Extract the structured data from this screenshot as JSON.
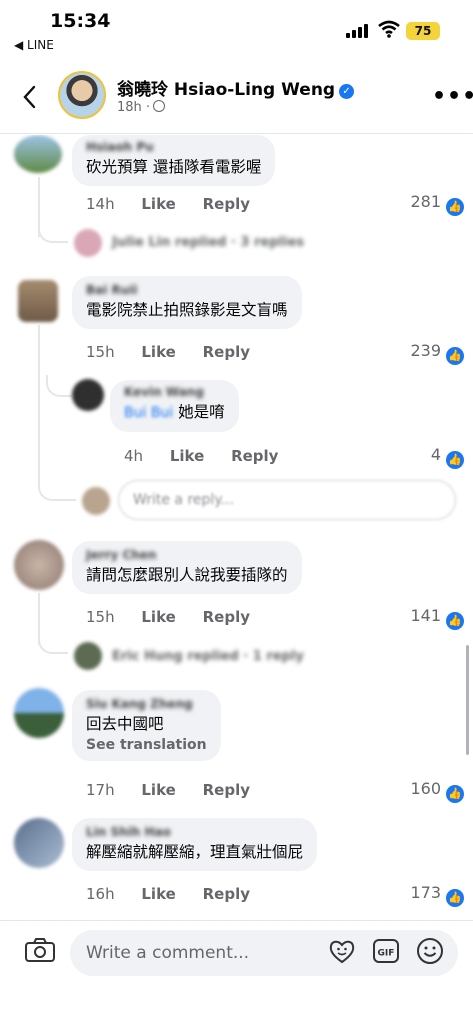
{
  "status_bar": {
    "time": "15:34",
    "back_app": "◀ LINE",
    "battery": "75"
  },
  "header": {
    "author": "翁曉玲 Hsiao-Ling  Weng",
    "time": "18h ·"
  },
  "labels": {
    "like": "Like",
    "reply": "Reply"
  },
  "comments": [
    {
      "name": "Hsiaoh Pu",
      "text": "砍光預算 還插隊看電影喔",
      "time": "14h",
      "likes": "281"
    },
    {
      "name": "Bai Ruii",
      "text": "電影院禁止拍照錄影是文盲嗎",
      "time": "15h",
      "likes": "239"
    },
    {
      "name": "Jerry Chen",
      "text": "請問怎麼跟別人說我要插隊的",
      "time": "15h",
      "likes": "141"
    },
    {
      "name": "Siu Kang Zheng",
      "text": "回去中國吧",
      "translate": "See translation",
      "time": "17h",
      "likes": "160"
    },
    {
      "name": "Lin Shih Hao",
      "text": "解壓縮就解壓縮，理直氣壯個屁",
      "time": "16h",
      "likes": "173"
    }
  ],
  "nested_reply": {
    "name": "Kevin Wang",
    "tag": "Bui Bui",
    "text": "她是唷",
    "time": "4h",
    "likes": "4"
  },
  "replied_links": [
    "Julie Lin replied · 3 replies",
    "Eric Hung replied · 1 reply"
  ],
  "write_reply_placeholder": "Write a reply...",
  "composer": {
    "placeholder": "Write a comment..."
  },
  "colors": {
    "accent": "#1877f2",
    "bubble": "#f0f2f5",
    "muted": "#65676b"
  },
  "icons": [
    "chevron-left-icon",
    "verified-badge-icon",
    "globe-icon",
    "more-icon",
    "like-icon",
    "camera-icon",
    "avatar-sticker-icon",
    "gif-icon",
    "emoji-icon"
  ]
}
